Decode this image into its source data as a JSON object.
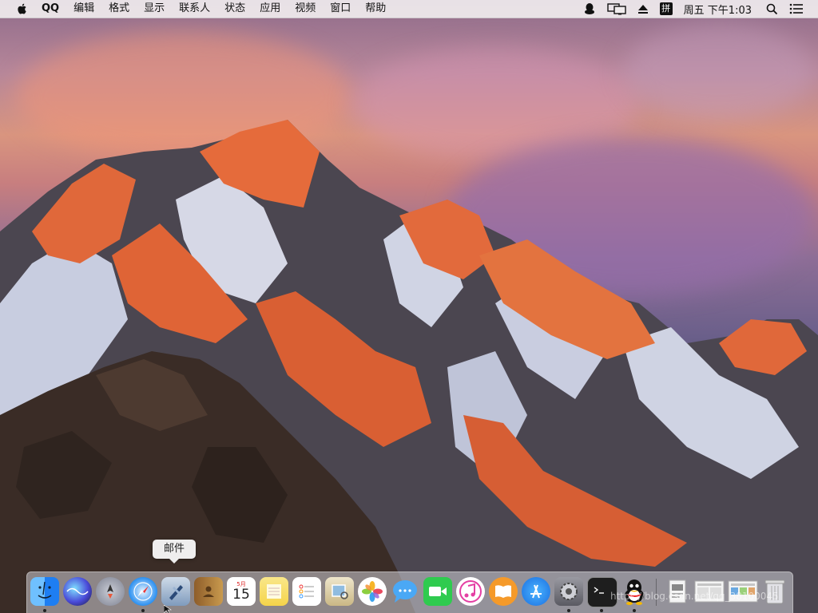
{
  "menubar": {
    "app_name": "QQ",
    "items": [
      "编辑",
      "格式",
      "显示",
      "联系人",
      "状态",
      "应用",
      "视频",
      "窗口",
      "帮助"
    ],
    "clock": "周五 下午1:03",
    "input_method": "拼"
  },
  "tooltip": {
    "label": "邮件"
  },
  "dock": {
    "apps": [
      {
        "name": "finder-icon",
        "color": "#2f8cf5"
      },
      {
        "name": "siri-icon",
        "color": "#3b3b8f"
      },
      {
        "name": "launchpad-icon",
        "color": "#8a8a9a"
      },
      {
        "name": "safari-icon",
        "color": "#2a8ff0"
      },
      {
        "name": "mail-icon",
        "color": "#6f8fb8"
      },
      {
        "name": "contacts-icon",
        "color": "#b8843c"
      },
      {
        "name": "calendar-icon",
        "color": "#ffffff",
        "date": "15",
        "month": "5月"
      },
      {
        "name": "notes-icon",
        "color": "#f5d44a"
      },
      {
        "name": "reminders-icon",
        "color": "#ffffff"
      },
      {
        "name": "preview-icon",
        "color": "#d9c9a0"
      },
      {
        "name": "photos-icon",
        "color": "#ffffff"
      },
      {
        "name": "messages-icon",
        "color": "#4aa8f5"
      },
      {
        "name": "facetime-icon",
        "color": "#2fcb4f"
      },
      {
        "name": "itunes-icon",
        "color": "#ffffff"
      },
      {
        "name": "ibooks-icon",
        "color": "#f59a2a"
      },
      {
        "name": "app-store-icon",
        "color": "#1a8ef0"
      },
      {
        "name": "system-preferences-icon",
        "color": "#7a7a80"
      },
      {
        "name": "terminal-icon",
        "color": "#1e1e1e"
      },
      {
        "name": "qq-icon",
        "color": "#111111"
      }
    ],
    "running_indicators": [
      "finder-icon",
      "safari-icon",
      "system-preferences-icon",
      "terminal-icon",
      "qq-icon"
    ],
    "documents": [
      "document-1",
      "document-2",
      "document-3"
    ],
    "trash": "trash-icon"
  },
  "watermark": "https://blog.csdn.net/qq_38100045"
}
